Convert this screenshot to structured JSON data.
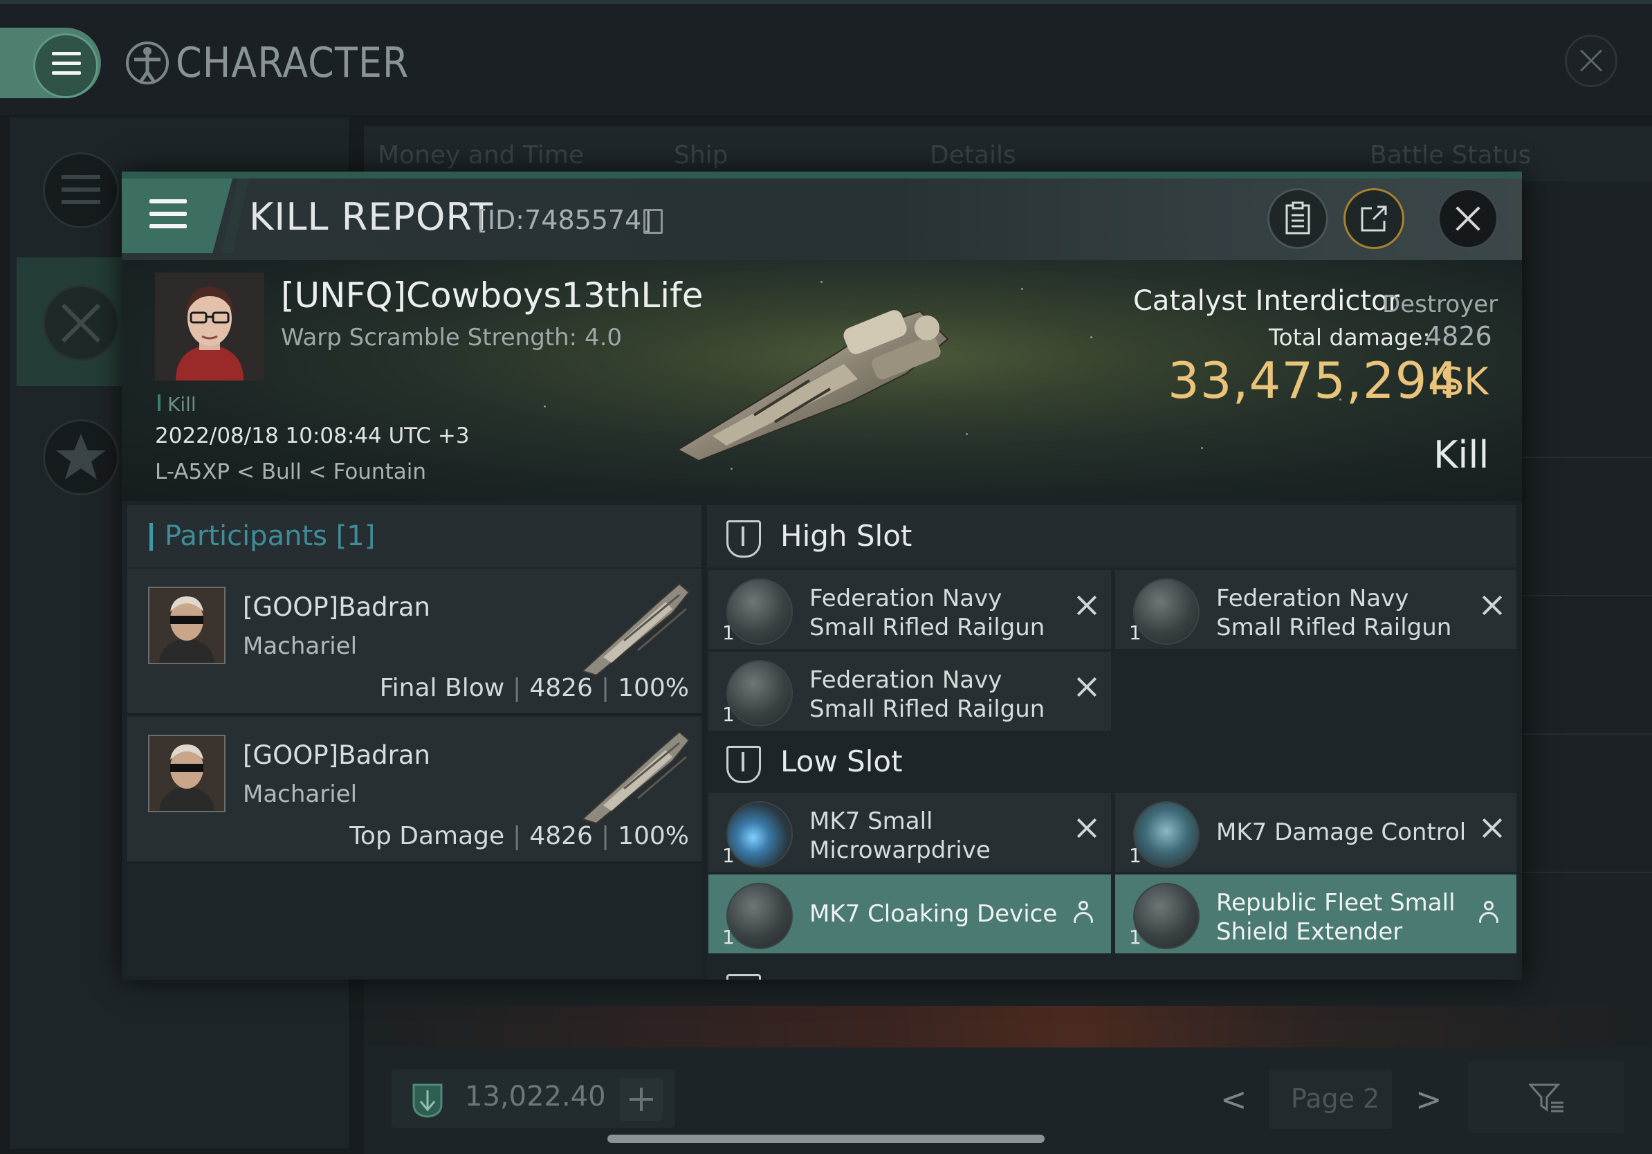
{
  "window": {
    "title": "CHARACTER",
    "menu_icon": "hamburger-icon",
    "close_icon": "close-icon"
  },
  "left_rail": {
    "items": [
      {
        "icon": "list-icon",
        "active": false
      },
      {
        "icon": "crossed-swords-icon",
        "active": true
      },
      {
        "icon": "star-badge-icon",
        "active": false
      }
    ]
  },
  "background_tabs": [
    "Money and Time",
    "Ship",
    "Details",
    "Battle Status"
  ],
  "bottom_bar": {
    "isk_value": "13,022.40",
    "page_label": "Page 2",
    "prev": "<",
    "next": ">"
  },
  "kill_report": {
    "title": "KILL REPORT",
    "id": "[ID:7485574]",
    "victim": {
      "name": "[UNFQ]Cowboys13thLife",
      "warp_scramble": "Warp Scramble Strength: 4.0",
      "tag": "Kill",
      "timestamp": "2022/08/18 10:08:44 UTC +3",
      "location": "L-A5XP < Bull < Fountain"
    },
    "ship": {
      "name": "Catalyst Interdictor",
      "class": "Destroyer",
      "total_damage_label": "Total damage:",
      "total_damage": "4826",
      "isk_amount": "33,475,294",
      "isk_unit": "ISK",
      "result": "Kill"
    },
    "participants": {
      "title": "Participants [1]",
      "rows": [
        {
          "name": "[GOOP]Badran",
          "ship": "Machariel",
          "label": "Final Blow",
          "damage": "4826",
          "percent": "100%"
        },
        {
          "name": "[GOOP]Badran",
          "ship": "Machariel",
          "label": "Top Damage",
          "damage": "4826",
          "percent": "100%"
        }
      ]
    },
    "high_slot": {
      "title": "High Slot",
      "items": [
        {
          "qty": "1",
          "name": "Federation Navy Small Rifled Railgun",
          "status": "destroyed"
        },
        {
          "qty": "1",
          "name": "Federation Navy Small Rifled Railgun",
          "status": "destroyed"
        },
        {
          "qty": "1",
          "name": "Federation Navy Small Rifled Railgun",
          "status": "destroyed"
        }
      ]
    },
    "low_slot": {
      "title": "Low Slot",
      "items": [
        {
          "qty": "1",
          "name": "MK7 Small Microwarpdrive",
          "status": "destroyed"
        },
        {
          "qty": "1",
          "name": "MK7 Damage Control",
          "status": "destroyed"
        },
        {
          "qty": "1",
          "name": "MK7 Cloaking Device",
          "status": "dropped"
        },
        {
          "qty": "1",
          "name": "Republic Fleet Small Shield Extender",
          "status": "dropped"
        }
      ]
    },
    "colors": {
      "accent": "#4b7a73",
      "isk": "#e9c47a",
      "participants_title": "#3f8d9a"
    }
  }
}
